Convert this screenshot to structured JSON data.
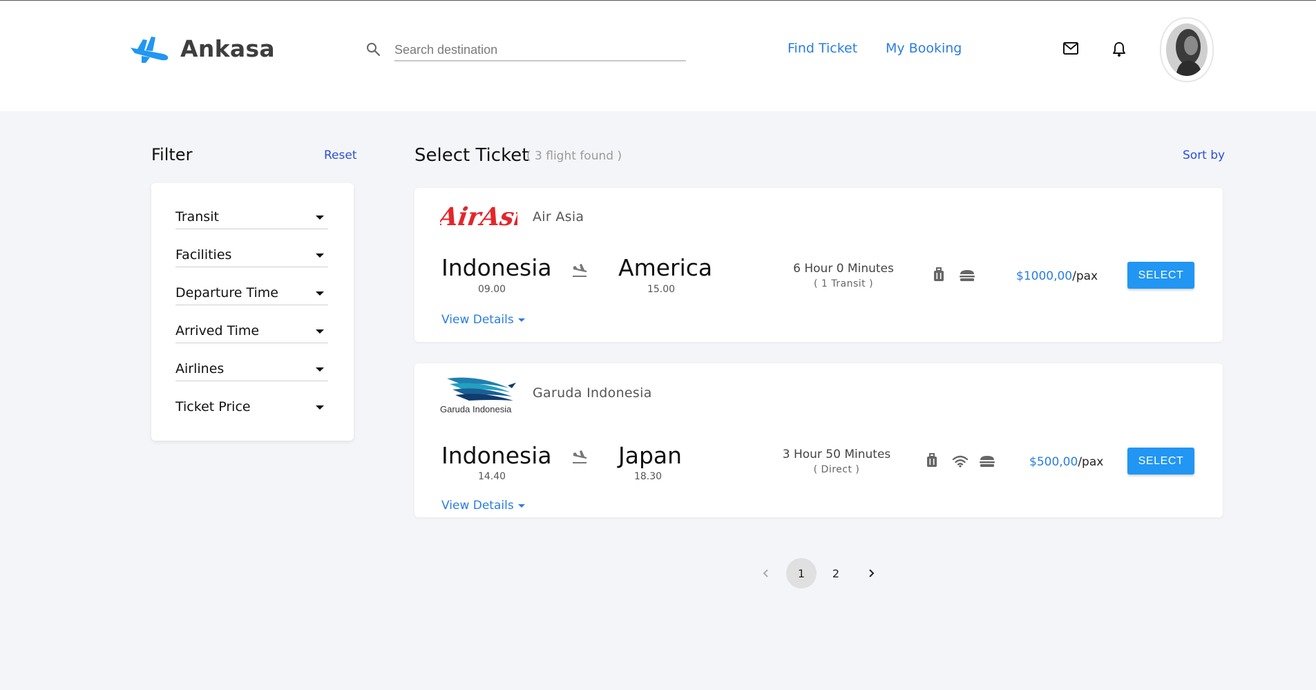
{
  "header": {
    "brand": "Ankasa",
    "search": {
      "placeholder": "Search destination",
      "value": ""
    },
    "nav": [
      {
        "label": "Find Ticket"
      },
      {
        "label": "My Booking"
      }
    ],
    "icons": [
      "mail-icon",
      "bell-icon"
    ],
    "accent": "#2a7de1"
  },
  "filter": {
    "title": "Filter",
    "reset_label": "Reset",
    "items": [
      {
        "label": "Transit"
      },
      {
        "label": "Facilities"
      },
      {
        "label": "Departure Time"
      },
      {
        "label": "Arrived Time"
      },
      {
        "label": "Airlines"
      },
      {
        "label": "Ticket Price"
      }
    ]
  },
  "results": {
    "title": "Select Ticket",
    "count_text": "( 3 flight found )",
    "sort_label": "Sort by"
  },
  "tickets": [
    {
      "airline": "Air Asia",
      "logo_text": "AirAsia",
      "from": {
        "city": "Indonesia",
        "time": "09.00"
      },
      "to": {
        "city": "America",
        "time": "15.00"
      },
      "duration": "6 Hour 0 Minutes",
      "transit": "( 1 Transit )",
      "facilities": [
        "luggage-icon",
        "meal-icon"
      ],
      "price": "$1000,00",
      "price_unit": "/pax",
      "select_label": "SELECT",
      "details_label": "View Details"
    },
    {
      "airline": "Garuda Indonesia",
      "logo_text": "Garuda Indonesia",
      "from": {
        "city": "Indonesia",
        "time": "14.40"
      },
      "to": {
        "city": "Japan",
        "time": "18.30"
      },
      "duration": "3 Hour 50 Minutes",
      "transit": "( Direct )",
      "facilities": [
        "luggage-icon",
        "wifi-icon",
        "meal-icon"
      ],
      "price": "$500,00",
      "price_unit": "/pax",
      "select_label": "SELECT",
      "details_label": "View Details"
    }
  ],
  "pagination": {
    "pages": [
      "1",
      "2"
    ],
    "current": "1"
  }
}
